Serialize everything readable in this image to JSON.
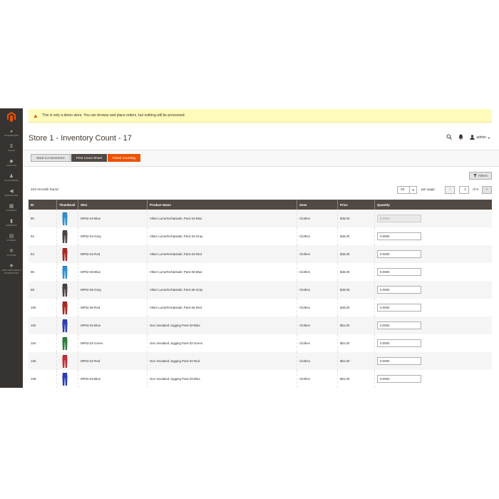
{
  "sidebar": {
    "items": [
      {
        "label": "Dashboard",
        "icon": "dashboard-icon",
        "glyph": "◕"
      },
      {
        "label": "Sales",
        "icon": "dollar-icon",
        "glyph": "$"
      },
      {
        "label": "Catalog",
        "icon": "cube-icon",
        "glyph": "◆"
      },
      {
        "label": "Customers",
        "icon": "person-icon",
        "glyph": "♟"
      },
      {
        "label": "Marketing",
        "icon": "megaphone-icon",
        "glyph": "◀"
      },
      {
        "label": "Content",
        "icon": "layout-icon",
        "glyph": "▦"
      },
      {
        "label": "Reports",
        "icon": "bar-chart-icon",
        "glyph": "▮"
      },
      {
        "label": "Stores",
        "icon": "store-icon",
        "glyph": "▤"
      },
      {
        "label": "System",
        "icon": "gear-icon",
        "glyph": "✲"
      },
      {
        "label": "Find Partners & Extensions",
        "icon": "puzzle-icon",
        "glyph": "❖"
      }
    ]
  },
  "notice": {
    "text": "This is only a demo store. You can browse and place orders, but nothing will be processed."
  },
  "header": {
    "title": "Store 1 - Inventory Count - 17",
    "user": "admin"
  },
  "toolbar": {
    "back_label": "Back to Inventories",
    "print_label": "Print Count Sheet",
    "finish_label": "Finish Counting"
  },
  "grid": {
    "filters_label": "Filters",
    "records_text": "104 records found",
    "per_page_value": "20",
    "per_page_label": "per page",
    "current_page": "1",
    "of_pages": "of 6",
    "columns": [
      "ID",
      "Thumbnail",
      "SKU",
      "Product Name",
      "Zone",
      "Price",
      "Quantity"
    ],
    "rows": [
      {
        "id": "90",
        "sku": "MP02-34-Blue",
        "name": "Viktor LumaTech&trade; Pant-34-Blue",
        "zone": "Clothes",
        "price": "$46.00",
        "qty": "0.0000",
        "color": "#2f8fcf",
        "disabled": true
      },
      {
        "id": "92",
        "sku": "MP02-34-Gray",
        "name": "Viktor LumaTech&trade; Pant-34-Gray",
        "zone": "Clothes",
        "price": "$46.00",
        "qty": "0.0000",
        "color": "#4a4340",
        "disabled": false
      },
      {
        "id": "94",
        "sku": "MP02-34-Red",
        "name": "Viktor LumaTech&trade; Pant-34-Red",
        "zone": "Clothes",
        "price": "$46.00",
        "qty": "0.0000",
        "color": "#a52a22",
        "disabled": false
      },
      {
        "id": "96",
        "sku": "MP02-36-Blue",
        "name": "Viktor LumaTech&trade; Pant-36-Blue",
        "zone": "Clothes",
        "price": "$46.00",
        "qty": "0.0000",
        "color": "#2f8fcf",
        "disabled": false
      },
      {
        "id": "98",
        "sku": "MP02-36-Gray",
        "name": "Viktor LumaTech&trade; Pant-36-Gray",
        "zone": "Clothes",
        "price": "$46.00",
        "qty": "0.0000",
        "color": "#4a4340",
        "disabled": false
      },
      {
        "id": "100",
        "sku": "MP02-36-Red",
        "name": "Viktor LumaTech&trade; Pant-36-Red",
        "zone": "Clothes",
        "price": "$46.00",
        "qty": "0.0000",
        "color": "#a52a22",
        "disabled": false
      },
      {
        "id": "102",
        "sku": "MP03-32-Blue",
        "name": "Geo Insulated Jogging Pant-32-Blue",
        "zone": "Clothes",
        "price": "$51.00",
        "qty": "0.0000",
        "color": "#2b3fb5",
        "disabled": false
      },
      {
        "id": "104",
        "sku": "MP03-32-Green",
        "name": "Geo Insulated Jogging Pant-32-Green",
        "zone": "Clothes",
        "price": "$51.00",
        "qty": "0.0000",
        "color": "#2e7d3a",
        "disabled": false
      },
      {
        "id": "106",
        "sku": "MP03-32-Red",
        "name": "Geo Insulated Jogging Pant-32-Red",
        "zone": "Clothes",
        "price": "$51.00",
        "qty": "0.0000",
        "color": "#c0303a",
        "disabled": false
      },
      {
        "id": "108",
        "sku": "MP03-33-Blue",
        "name": "Geo Insulated Jogging Pant-33-Blue",
        "zone": "Clothes",
        "price": "$51.00",
        "qty": "0.0000",
        "color": "#2b3fb5",
        "disabled": false
      }
    ]
  },
  "colors": {
    "sidebar": "#373330",
    "accent": "#eb5202",
    "header_row": "#514943",
    "notice": "#fffbbb"
  }
}
